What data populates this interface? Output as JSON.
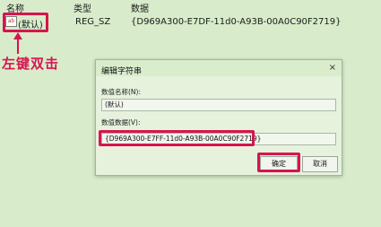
{
  "table": {
    "headers": {
      "name": "名称",
      "type": "类型",
      "data": "数据"
    },
    "row": {
      "icon": "ab",
      "name": "(默认)",
      "type": "REG_SZ",
      "data": "{D969A300-E7DF-11d0-A93B-00A0C90F2719}"
    }
  },
  "annotation": "左键双击",
  "dialog": {
    "title": "编辑字符串",
    "close": "×",
    "name_label": "数值名称(N):",
    "name_value": "(默认)",
    "data_label": "数值数据(V):",
    "data_value": "{D969A300-E7FF-11d0-A93B-00A0C90F2719}",
    "ok_label": "确定",
    "cancel_label": "取消"
  },
  "colors": {
    "background": "#d8eccb",
    "highlight": "#d6154f"
  }
}
